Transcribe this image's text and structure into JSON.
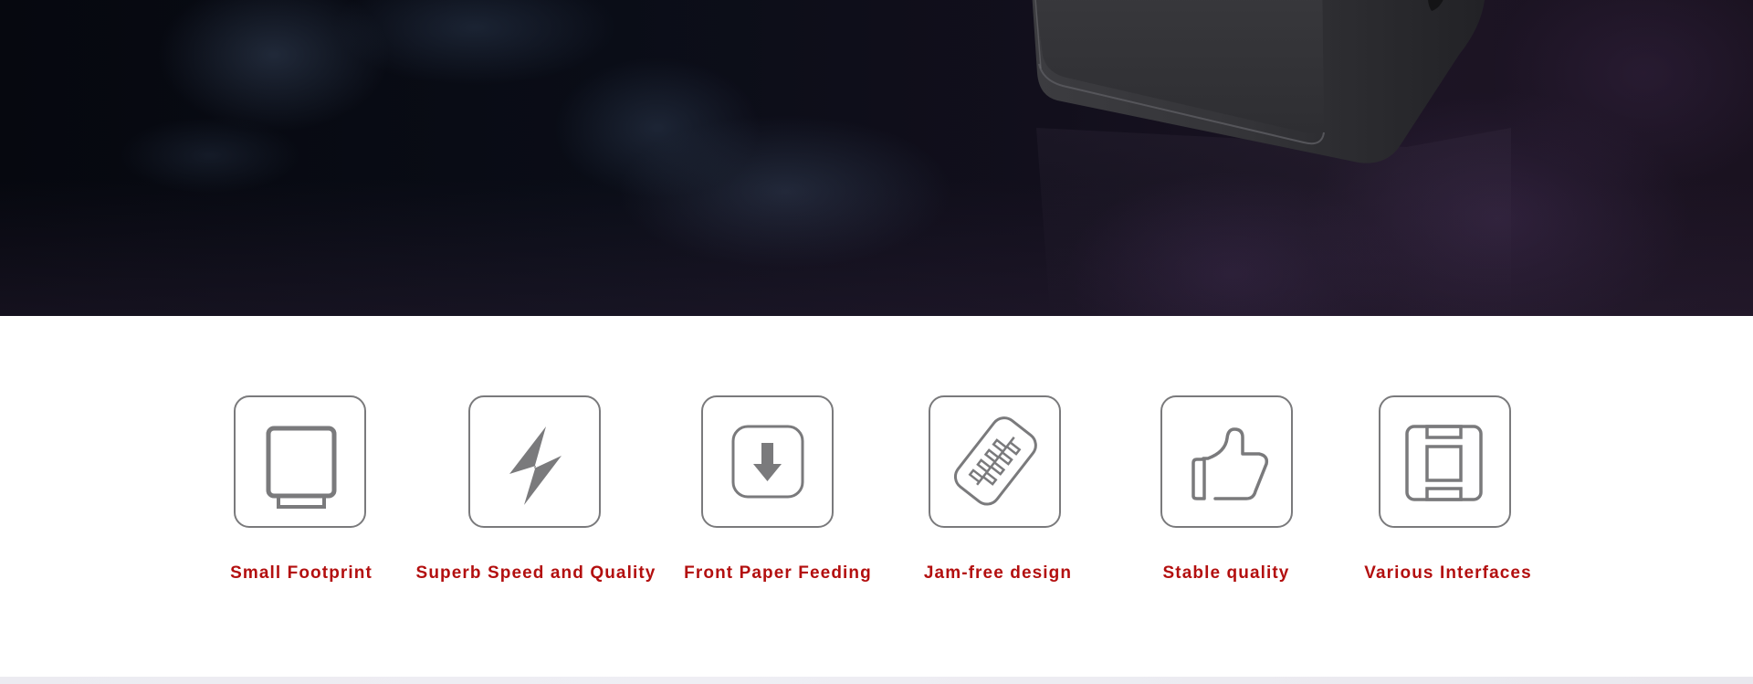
{
  "hero": {
    "image_alt": "Black thermal receipt printer on dark world-map background",
    "colors": {
      "background_dark": "#0a0d17",
      "background_purple": "#1c1424",
      "printer_body": "#3a3a3e"
    }
  },
  "features": {
    "icon_color": "#7a7a7c",
    "label_color": "#b30f0f",
    "items": [
      {
        "icon": "printer-footprint-icon",
        "label": "Small Footprint"
      },
      {
        "icon": "lightning-bolt-icon",
        "label": "Superb Speed and Quality"
      },
      {
        "icon": "front-feed-arrow-icon",
        "label": "Front Paper Feeding"
      },
      {
        "icon": "zipper-icon",
        "label": "Jam-free design"
      },
      {
        "icon": "thumbs-up-icon",
        "label": "Stable quality"
      },
      {
        "icon": "interface-port-icon",
        "label": "Various Interfaces"
      }
    ]
  }
}
